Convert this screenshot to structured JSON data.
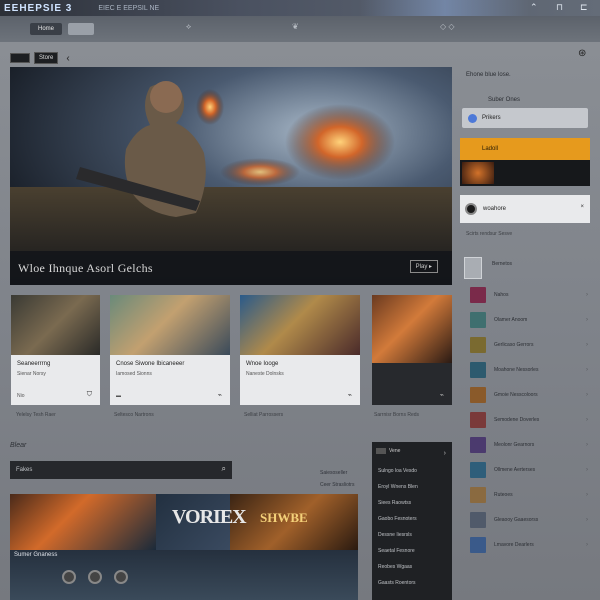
{
  "titlebar": {
    "app_name": "EEHEPSIE 3",
    "crumb": "EIEC E EEPSIL NE",
    "icons": [
      "minimize-icon",
      "window-icon",
      "close-icon"
    ]
  },
  "tabs": [
    {
      "label": "Home"
    },
    {
      "label": ""
    }
  ],
  "nav": {
    "chip1": "",
    "chip2": "Store"
  },
  "hero": {
    "title": "Wloe Ihnque Asorl Gelchs",
    "button": "Play ▸"
  },
  "rail": {
    "heading": "Ehone blue lose.",
    "sub": "Suber Ones",
    "search_label": "Prikers",
    "promo_label": "Ladoll",
    "account_name": "woahore",
    "account_x": "×",
    "label": "Scirts rendsur Sesve",
    "items": [
      {
        "label": "Bernetos",
        "color": "#9aa0a8"
      },
      {
        "label": "Nahos",
        "color": "#7a2a4a"
      },
      {
        "label": "Olamer Anoom",
        "color": "#3f6f6f"
      },
      {
        "label": "Gerlicaso Gerrors",
        "color": "#7a6a30"
      },
      {
        "label": "Moahone Nessorles",
        "color": "#2d5a6e"
      },
      {
        "label": "Gmoie Nesscoloors",
        "color": "#8a5a2a"
      },
      {
        "label": "Semodene Doverles",
        "color": "#7a3a3a"
      },
      {
        "label": "Meolonr Gearnors",
        "color": "#4b3a6e"
      },
      {
        "label": "Ollmene Aerterses",
        "color": "#2e5e7a"
      },
      {
        "label": "Ruteoes",
        "color": "#8a6a40"
      },
      {
        "label": "Gleaooy Gaaesorss",
        "color": "#505a6a"
      },
      {
        "label": "Lmavore Dearlers",
        "color": "#3a5a8a"
      }
    ]
  },
  "cards": [
    {
      "name": "Seaneerrrng",
      "meta": "Sienar Norsy",
      "foot": "Nio",
      "icon": "shield-icon"
    },
    {
      "name": "Cnose Siwone Ibicaneeer",
      "meta": "Iamosed Sionns",
      "foot": "▬",
      "icon": "controller-icon"
    },
    {
      "name": "Wnoe Iooge",
      "meta": "Naneste Dolnsks",
      "foot": "",
      "icon": "controller-icon"
    },
    {
      "name": "",
      "meta": "",
      "foot": "",
      "icon": "controller-icon"
    }
  ],
  "row_meta": [
    "Yelelsy Tesh Raer",
    "Seltesco Nartrons",
    "Selliat Parrossers",
    "Sarrnisr Borns Reds"
  ],
  "section": {
    "title": "Blear",
    "search_placeholder": "Fakes",
    "links": [
      "Saiesoseller",
      "Ceer Strasliotrs"
    ]
  },
  "banner": {
    "caption": "Sumer Gnaness",
    "logo": "VORIEX",
    "logo2": "SHWBE"
  },
  "popup": {
    "header": "Vene",
    "items": [
      "Sulngo loa Vesdo",
      "Eroyl Wnens Blen",
      "Siees Raowtss",
      "Gaobo Fesnoters",
      "Dessne Iiesrsls",
      "Seaetal Fesnore",
      "Reobes Wgaas",
      "Gaasts Roentors"
    ]
  }
}
